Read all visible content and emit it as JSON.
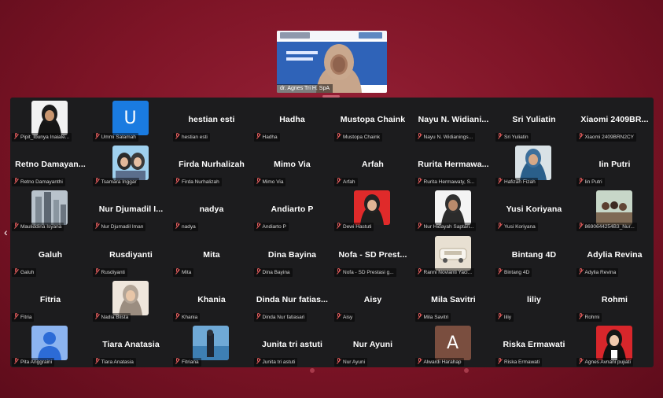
{
  "speaker": {
    "name": "dr. Agnes Tri H. SpA",
    "slide_title": "Tidak Hanya Pi Harus Cerdas T"
  },
  "colors": {
    "background": "#7d1426",
    "panel": "#1c1c1e",
    "muted_mic": "#e15b5b"
  },
  "icons": {
    "muted": "mic-off-icon",
    "prev": "chevron-left-icon"
  },
  "nav": {
    "prev": "‹"
  },
  "tiles": [
    {
      "type": "photo",
      "thumb": "hijab-white",
      "label": "Pipit_Ibunya Inaiale..."
    },
    {
      "type": "letter",
      "letter": "U",
      "color": "#1a7be0",
      "label": "Ummi Salamah"
    },
    {
      "type": "name",
      "name": "hestian esti",
      "label": "hestian esti"
    },
    {
      "type": "name",
      "name": "Hadha",
      "label": "Hadha"
    },
    {
      "type": "name",
      "name": "Mustopa Chaink",
      "label": "Mustopa Chaink"
    },
    {
      "type": "name",
      "name": "Nayu N. Widiani...",
      "label": "Nayu N. Widianings..."
    },
    {
      "type": "name",
      "name": "Sri Yuliatin",
      "label": "Sri Yuliatin"
    },
    {
      "type": "name",
      "name": "Xiaomi 2409BR...",
      "label": "Xiaomi 2409BRN2CY"
    },
    {
      "type": "name",
      "name": "Retno Damayan...",
      "label": "Retno Damayanthi"
    },
    {
      "type": "photo",
      "thumb": "two-people",
      "label": "Tsamara Inggar"
    },
    {
      "type": "name",
      "name": "Firda Nurhalizah",
      "label": "Firda Nurhalizah"
    },
    {
      "type": "name",
      "name": "Mimo Via",
      "label": "Mimo Via"
    },
    {
      "type": "name",
      "name": "Arfah",
      "label": "Arfah"
    },
    {
      "type": "name",
      "name": "Rurita Hermawa...",
      "label": "Rurita Hermawaty, S..."
    },
    {
      "type": "photo",
      "thumb": "hijab-outdoor",
      "label": "Hafizah Fizah"
    },
    {
      "type": "name",
      "name": "Iin Putri",
      "label": "Iin Putri"
    },
    {
      "type": "photo",
      "thumb": "city",
      "label": "Mauliddina Isyana"
    },
    {
      "type": "name",
      "name": "Nur Djumadil I...",
      "label": "Nur Djumadil Iman"
    },
    {
      "type": "name",
      "name": "nadya",
      "label": "nadya"
    },
    {
      "type": "name",
      "name": "Andiarto P",
      "label": "Andiarto P"
    },
    {
      "type": "photo",
      "thumb": "hijab-red",
      "label": "Dewi Hastuti"
    },
    {
      "type": "photo",
      "thumb": "hijab-dark",
      "label": "Nur Hidayah Saptari..."
    },
    {
      "type": "name",
      "name": "Yusi Koriyana",
      "label": "Yusi Koriyana"
    },
    {
      "type": "photo",
      "thumb": "group",
      "label": "8690644254B3_Nur..."
    },
    {
      "type": "name",
      "name": "Galuh",
      "label": "Galuh"
    },
    {
      "type": "name",
      "name": "Rusdiyanti",
      "label": "Rusdiyanti"
    },
    {
      "type": "name",
      "name": "Mita",
      "label": "Mita"
    },
    {
      "type": "name",
      "name": "Dina Bayina",
      "label": "Dina Bayina"
    },
    {
      "type": "name",
      "name": "Nofa - SD Prest...",
      "label": "Nofa - SD Prestasi g..."
    },
    {
      "type": "photo",
      "thumb": "car",
      "label": "Ranni Novianti Yaci..."
    },
    {
      "type": "name",
      "name": "Bintang 4D",
      "label": "Bintang 4D"
    },
    {
      "type": "name",
      "name": "Adylia Revina",
      "label": "Adylia Revina"
    },
    {
      "type": "name",
      "name": "Fitria",
      "label": "Fitria"
    },
    {
      "type": "photo",
      "thumb": "hijab-beige",
      "label": "Nadia Blista"
    },
    {
      "type": "name",
      "name": "Khania",
      "label": "Khania"
    },
    {
      "type": "name",
      "name": "Dinda Nur fatias...",
      "label": "Dinda Nur fatiasari"
    },
    {
      "type": "name",
      "name": "Aisy",
      "label": "Aisy"
    },
    {
      "type": "name",
      "name": "Mila Savitri",
      "label": "Mila Savitri"
    },
    {
      "type": "name",
      "name": "liliy",
      "label": "liliy"
    },
    {
      "type": "name",
      "name": "Rohmi",
      "label": "Rohmi"
    },
    {
      "type": "photo",
      "thumb": "default-user",
      "label": "Pita Anggraini"
    },
    {
      "type": "name",
      "name": "Tiara Anatasia",
      "label": "Tiara Anatasia"
    },
    {
      "type": "photo",
      "thumb": "man-sea",
      "label": "Fitriana"
    },
    {
      "type": "name",
      "name": "Junita tri astuti",
      "label": "Junita tri astuti"
    },
    {
      "type": "name",
      "name": "Nur Ayuni",
      "label": "Nur Ayuni"
    },
    {
      "type": "letter",
      "letter": "A",
      "color": "#7a4e3f",
      "label": "Alwardi Harahap"
    },
    {
      "type": "name",
      "name": "Riska Ermawati",
      "label": "Riska Ermawati"
    },
    {
      "type": "photo",
      "thumb": "hijab-black-red",
      "label": "Agnes Avnani pujiati"
    }
  ]
}
